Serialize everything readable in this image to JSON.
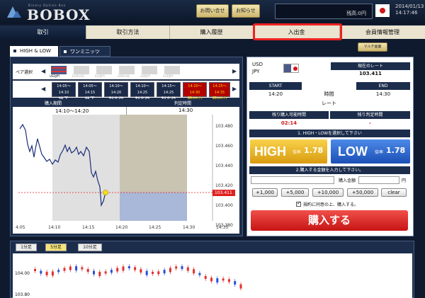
{
  "header": {
    "logo": "BOBOX",
    "logo_sub": "Binary Option Box",
    "contact_button": "お問い合せ",
    "news_button": "お知らせ",
    "balance": "残高:0円",
    "date": "2014/01/13",
    "time": "14:17:46"
  },
  "nav": {
    "tabs": [
      "取引",
      "取引方法",
      "購入履歴",
      "入出金",
      "会員情報管理"
    ]
  },
  "subtabs": {
    "high_low": "HIGH & LOW",
    "one_minutes": "ワンミニッツ",
    "multi_screen": "マルチ画面"
  },
  "pair_select": {
    "label": "ペア選択",
    "pairs": [
      "USDJPY",
      "EURUSD",
      "EURJPY",
      "GBPUSD",
      "GBPJPY",
      "AUDJPY"
    ]
  },
  "time_slots": [
    {
      "range": "14:05〜14:10",
      "status": "終了"
    },
    {
      "range": "14:05〜14:15",
      "status": "終了"
    },
    {
      "range": "14:10〜14:20",
      "status": "判定待"
    },
    {
      "range": "14:10〜14:25",
      "status": "判定待"
    },
    {
      "range": "14:15〜14:25",
      "status": "判定待"
    },
    {
      "range": "14:20〜14:30",
      "status": "受付中"
    },
    {
      "range": "14:25〜14:35",
      "status": "受付中"
    }
  ],
  "period": {
    "purchase_label": "購入期間",
    "purchase_value": "14:10〜14:20",
    "judge_label": "判定時間",
    "judge_value": "14:30"
  },
  "line_chart": {
    "current_rate_label": "103.411",
    "y_ticks": [
      "103.480",
      "103.460",
      "103.440",
      "103.420",
      "103.400",
      "103.380"
    ],
    "x_ticks": [
      "4:05",
      "14:10",
      "14:15",
      "14:20",
      "14:25",
      "14:30",
      "14:35"
    ]
  },
  "rate_panel": {
    "pair_line1": "USD",
    "pair_line2": "JPY",
    "current_rate_label": "現在のレート",
    "current_rate": "103.411",
    "start_label": "START",
    "end_label": "END",
    "start_time": "14:20",
    "time_label": "時間",
    "end_time": "14:30",
    "rate_label": "レート",
    "remaining_buy_label": "残り購入可能時間",
    "remaining_judge_label": "残り判定時間",
    "remaining_buy": "02:14",
    "remaining_judge": "-",
    "step1": "1. HIGH・LOWを選択して下さい",
    "high_label": "HIGH",
    "high_payout_label": "倍率",
    "high_payout": "1.78",
    "low_label": "LOW",
    "low_payout_label": "倍率",
    "low_payout": "1.78",
    "step2": "2.購入する金額を入力して下さい。",
    "amount_label": "購入金額",
    "amount_unit": "円",
    "amount_buttons": [
      "+1,000",
      "+5,000",
      "+10,000",
      "+50,000",
      "clear"
    ],
    "agree_text": "規約に同意の上、購入する。",
    "buy_button": "購入する"
  },
  "candle_chart": {
    "timeframes": [
      "1分足",
      "5分足",
      "10分足"
    ],
    "y_ticks": [
      "104.00",
      "103.80"
    ]
  }
}
